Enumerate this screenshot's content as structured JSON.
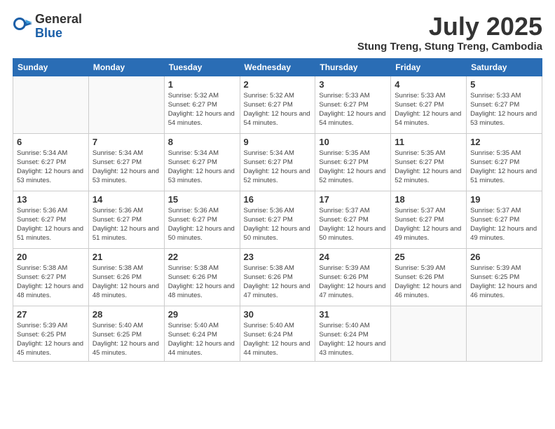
{
  "logo": {
    "general": "General",
    "blue": "Blue"
  },
  "title": "July 2025",
  "location": "Stung Treng, Stung Treng, Cambodia",
  "days_header": [
    "Sunday",
    "Monday",
    "Tuesday",
    "Wednesday",
    "Thursday",
    "Friday",
    "Saturday"
  ],
  "weeks": [
    [
      {
        "day": "",
        "info": ""
      },
      {
        "day": "",
        "info": ""
      },
      {
        "day": "1",
        "info": "Sunrise: 5:32 AM\nSunset: 6:27 PM\nDaylight: 12 hours\nand 54 minutes."
      },
      {
        "day": "2",
        "info": "Sunrise: 5:32 AM\nSunset: 6:27 PM\nDaylight: 12 hours\nand 54 minutes."
      },
      {
        "day": "3",
        "info": "Sunrise: 5:33 AM\nSunset: 6:27 PM\nDaylight: 12 hours\nand 54 minutes."
      },
      {
        "day": "4",
        "info": "Sunrise: 5:33 AM\nSunset: 6:27 PM\nDaylight: 12 hours\nand 54 minutes."
      },
      {
        "day": "5",
        "info": "Sunrise: 5:33 AM\nSunset: 6:27 PM\nDaylight: 12 hours\nand 53 minutes."
      }
    ],
    [
      {
        "day": "6",
        "info": "Sunrise: 5:34 AM\nSunset: 6:27 PM\nDaylight: 12 hours\nand 53 minutes."
      },
      {
        "day": "7",
        "info": "Sunrise: 5:34 AM\nSunset: 6:27 PM\nDaylight: 12 hours\nand 53 minutes."
      },
      {
        "day": "8",
        "info": "Sunrise: 5:34 AM\nSunset: 6:27 PM\nDaylight: 12 hours\nand 53 minutes."
      },
      {
        "day": "9",
        "info": "Sunrise: 5:34 AM\nSunset: 6:27 PM\nDaylight: 12 hours\nand 52 minutes."
      },
      {
        "day": "10",
        "info": "Sunrise: 5:35 AM\nSunset: 6:27 PM\nDaylight: 12 hours\nand 52 minutes."
      },
      {
        "day": "11",
        "info": "Sunrise: 5:35 AM\nSunset: 6:27 PM\nDaylight: 12 hours\nand 52 minutes."
      },
      {
        "day": "12",
        "info": "Sunrise: 5:35 AM\nSunset: 6:27 PM\nDaylight: 12 hours\nand 51 minutes."
      }
    ],
    [
      {
        "day": "13",
        "info": "Sunrise: 5:36 AM\nSunset: 6:27 PM\nDaylight: 12 hours\nand 51 minutes."
      },
      {
        "day": "14",
        "info": "Sunrise: 5:36 AM\nSunset: 6:27 PM\nDaylight: 12 hours\nand 51 minutes."
      },
      {
        "day": "15",
        "info": "Sunrise: 5:36 AM\nSunset: 6:27 PM\nDaylight: 12 hours\nand 50 minutes."
      },
      {
        "day": "16",
        "info": "Sunrise: 5:36 AM\nSunset: 6:27 PM\nDaylight: 12 hours\nand 50 minutes."
      },
      {
        "day": "17",
        "info": "Sunrise: 5:37 AM\nSunset: 6:27 PM\nDaylight: 12 hours\nand 50 minutes."
      },
      {
        "day": "18",
        "info": "Sunrise: 5:37 AM\nSunset: 6:27 PM\nDaylight: 12 hours\nand 49 minutes."
      },
      {
        "day": "19",
        "info": "Sunrise: 5:37 AM\nSunset: 6:27 PM\nDaylight: 12 hours\nand 49 minutes."
      }
    ],
    [
      {
        "day": "20",
        "info": "Sunrise: 5:38 AM\nSunset: 6:27 PM\nDaylight: 12 hours\nand 48 minutes."
      },
      {
        "day": "21",
        "info": "Sunrise: 5:38 AM\nSunset: 6:26 PM\nDaylight: 12 hours\nand 48 minutes."
      },
      {
        "day": "22",
        "info": "Sunrise: 5:38 AM\nSunset: 6:26 PM\nDaylight: 12 hours\nand 48 minutes."
      },
      {
        "day": "23",
        "info": "Sunrise: 5:38 AM\nSunset: 6:26 PM\nDaylight: 12 hours\nand 47 minutes."
      },
      {
        "day": "24",
        "info": "Sunrise: 5:39 AM\nSunset: 6:26 PM\nDaylight: 12 hours\nand 47 minutes."
      },
      {
        "day": "25",
        "info": "Sunrise: 5:39 AM\nSunset: 6:26 PM\nDaylight: 12 hours\nand 46 minutes."
      },
      {
        "day": "26",
        "info": "Sunrise: 5:39 AM\nSunset: 6:25 PM\nDaylight: 12 hours\nand 46 minutes."
      }
    ],
    [
      {
        "day": "27",
        "info": "Sunrise: 5:39 AM\nSunset: 6:25 PM\nDaylight: 12 hours\nand 45 minutes."
      },
      {
        "day": "28",
        "info": "Sunrise: 5:40 AM\nSunset: 6:25 PM\nDaylight: 12 hours\nand 45 minutes."
      },
      {
        "day": "29",
        "info": "Sunrise: 5:40 AM\nSunset: 6:24 PM\nDaylight: 12 hours\nand 44 minutes."
      },
      {
        "day": "30",
        "info": "Sunrise: 5:40 AM\nSunset: 6:24 PM\nDaylight: 12 hours\nand 44 minutes."
      },
      {
        "day": "31",
        "info": "Sunrise: 5:40 AM\nSunset: 6:24 PM\nDaylight: 12 hours\nand 43 minutes."
      },
      {
        "day": "",
        "info": ""
      },
      {
        "day": "",
        "info": ""
      }
    ]
  ]
}
